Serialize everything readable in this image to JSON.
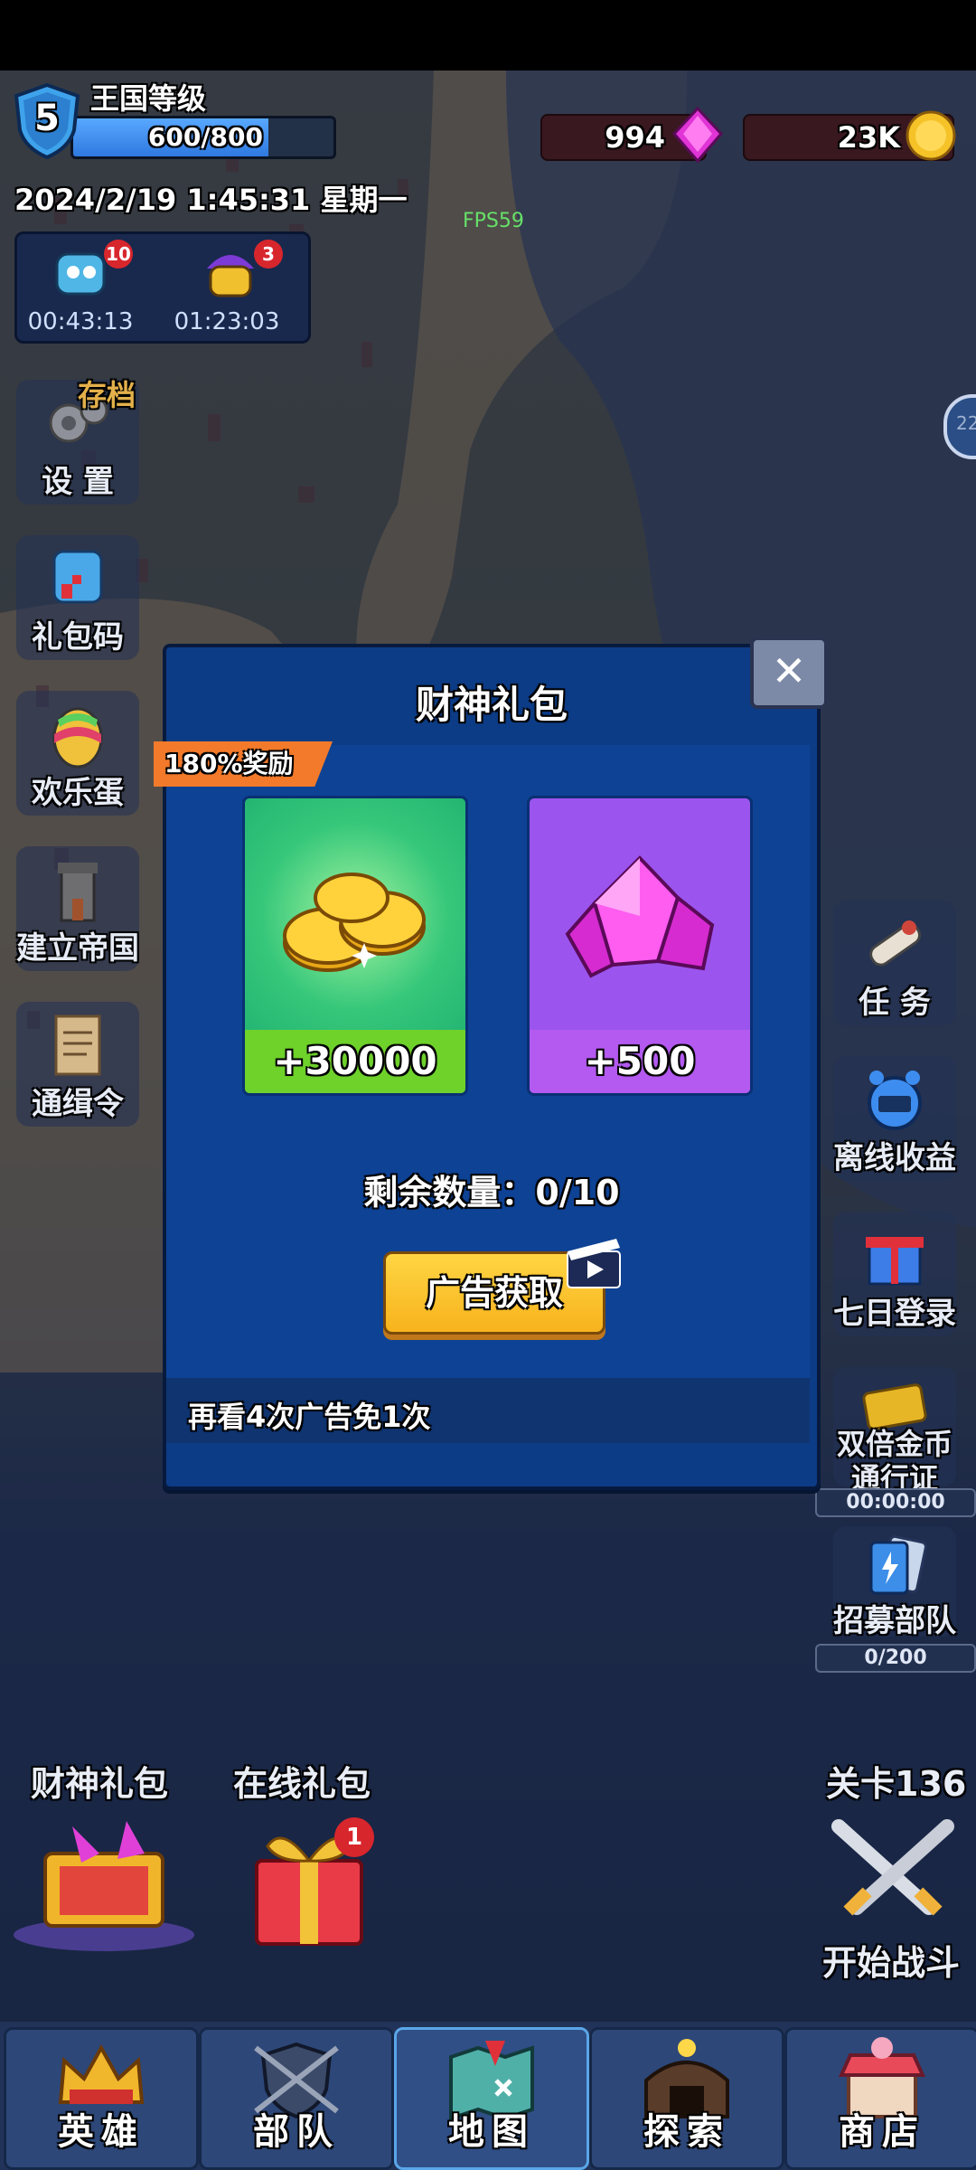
{
  "hud": {
    "level": "5",
    "level_title": "王国等级",
    "xp_text": "600/800",
    "xp_fraction": 0.75,
    "gems": "994",
    "coins": "23K",
    "datetime": "2024/2/19 1:45:31 星期一",
    "fps": "FPS59"
  },
  "timers": [
    {
      "badge": "10",
      "time": "00:43:13",
      "icon": "robot-hero-icon"
    },
    {
      "badge": "3",
      "time": "01:23:03",
      "icon": "wizard-hero-icon"
    }
  ],
  "left_menu": {
    "save_label": "存档",
    "settings": "设 置",
    "gift_code": "礼包码",
    "happy_egg": "欢乐蛋",
    "empire": "建立帝国",
    "wanted": "通缉令"
  },
  "right_menu": {
    "edge_badge": "22",
    "tasks": "任 务",
    "offline": "离线收益",
    "seven_day": "七日登录",
    "pass_line1": "双倍金币",
    "pass_line2": "通行证",
    "pass_timer": "00:00:00",
    "recruit": "招募部队",
    "recruit_count": "0/200"
  },
  "dialog": {
    "title": "财神礼包",
    "bonus": "180%奖励",
    "coin_reward": "+30000",
    "gem_reward": "+500",
    "remaining": "剩余数量：0/10",
    "ad_button": "广告获取",
    "footer": "再看4次广告免1次"
  },
  "bottom_gifts": {
    "god_pack": "财神礼包",
    "online_pack": "在线礼包",
    "online_badge": "1",
    "stage": "关卡136",
    "start": "开始战斗"
  },
  "nav": [
    {
      "label": "英雄",
      "icon": "crown-icon"
    },
    {
      "label": "部队",
      "icon": "shield-swords-icon"
    },
    {
      "label": "地图",
      "icon": "map-icon"
    },
    {
      "label": "探索",
      "icon": "mine-icon"
    },
    {
      "label": "商店",
      "icon": "shop-icon"
    }
  ],
  "colors": {
    "dialog_bg": "#0d3c86",
    "coin_card": "#17a86c",
    "gem_card": "#9b55ee",
    "ad_button": "#f7b31d",
    "bonus_ribbon": "#f37a2a"
  }
}
